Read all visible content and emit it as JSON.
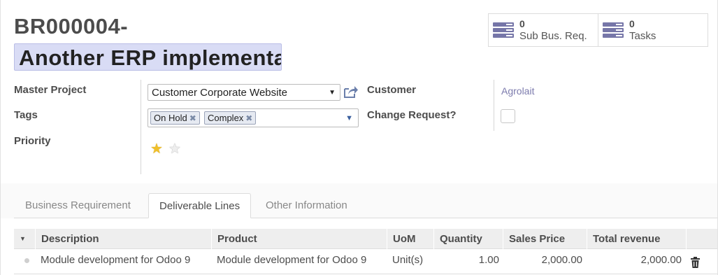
{
  "record": {
    "reference": "BR000004-",
    "name": "Another ERP implementa"
  },
  "smart_buttons": [
    {
      "count": "0",
      "label": "Sub Bus. Req.",
      "icon": "list-icon"
    },
    {
      "count": "0",
      "label": "Tasks",
      "icon": "list-icon"
    }
  ],
  "fields": {
    "master_project": {
      "label": "Master Project",
      "value": "Customer Corporate Website"
    },
    "tags": {
      "label": "Tags",
      "values": [
        "On Hold",
        "Complex"
      ]
    },
    "priority": {
      "label": "Priority",
      "value_stars": 1,
      "max_stars": 2
    },
    "customer": {
      "label": "Customer",
      "value": "Agrolait"
    },
    "change_request": {
      "label": "Change Request?",
      "checked": false
    }
  },
  "tabs": [
    {
      "label": "Business Requirement",
      "active": false
    },
    {
      "label": "Deliverable Lines",
      "active": true
    },
    {
      "label": "Other Information",
      "active": false
    }
  ],
  "table": {
    "columns": [
      "Description",
      "Product",
      "UoM",
      "Quantity",
      "Sales Price",
      "Total revenue"
    ],
    "rows": [
      {
        "description": "Module development for Odoo 9",
        "product": "Module development for Odoo 9",
        "uom": "Unit(s)",
        "quantity": "1.00",
        "sales_price": "2,000.00",
        "total_revenue": "2,000.00"
      }
    ]
  },
  "colors": {
    "accent": "#7c7bad",
    "name_highlight": "#d9dcf5",
    "star_on": "#f0c02a"
  }
}
